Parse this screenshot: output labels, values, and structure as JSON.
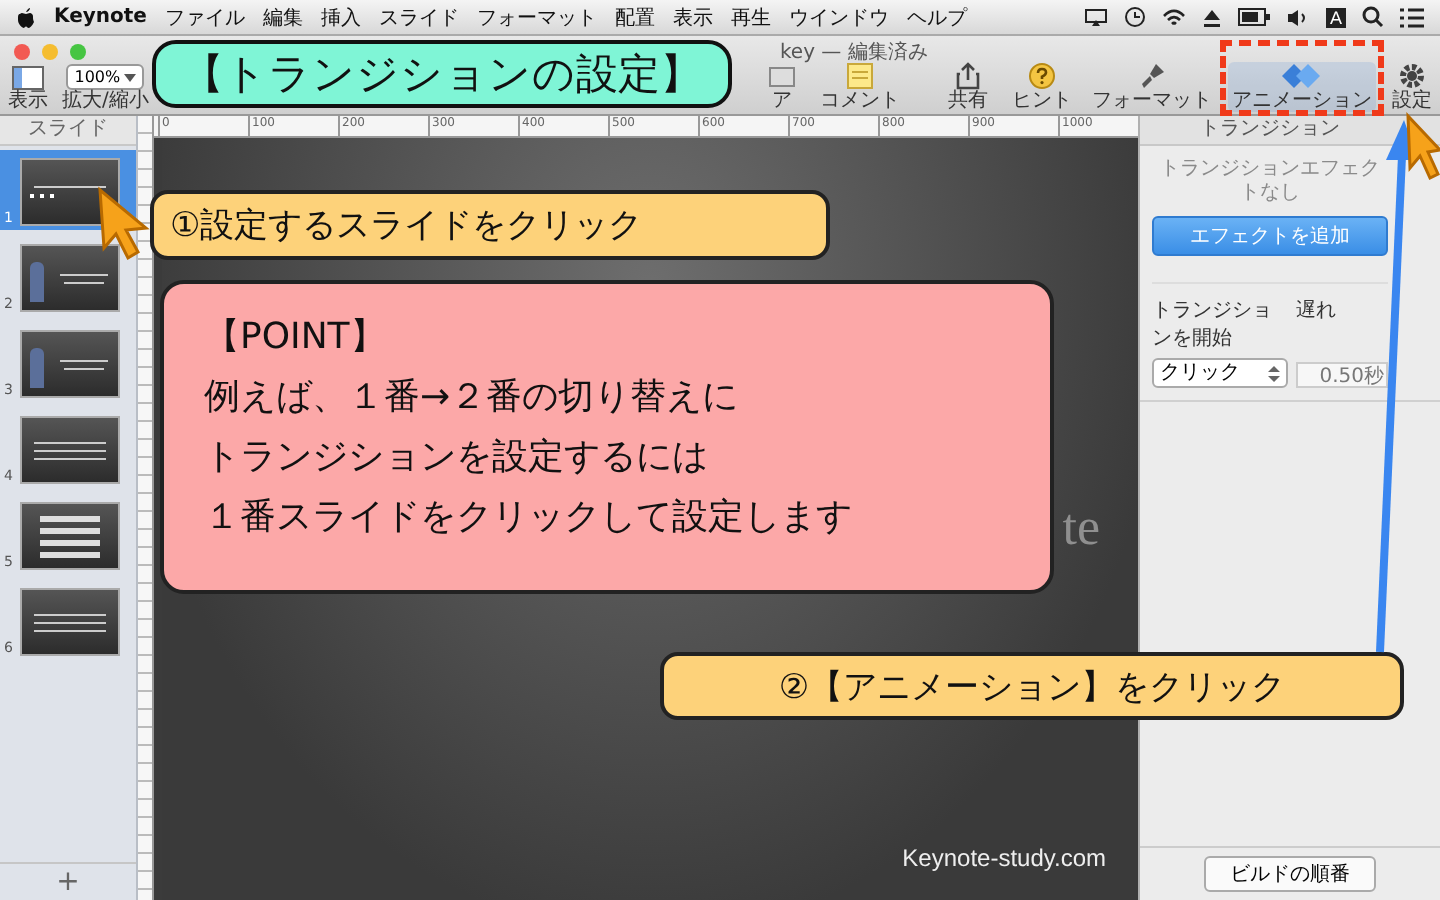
{
  "menu_bar": {
    "app": "Keynote",
    "items": [
      "ファイル",
      "編集",
      "挿入",
      "スライド",
      "フォーマット",
      "配置",
      "表示",
      "再生",
      "ウインドウ",
      "ヘルプ"
    ],
    "status_letter": "A"
  },
  "window": {
    "title": "key — 編集済み"
  },
  "toolbar": {
    "zoom": "100%",
    "left": [
      {
        "kind": "view",
        "label": "表示"
      },
      {
        "kind": "zoom",
        "label": "拡大/縮小"
      }
    ],
    "middle": [
      {
        "kind": "partial",
        "label": "ア"
      },
      {
        "kind": "comment",
        "label": "コメント"
      },
      {
        "kind": "share",
        "label": "共有"
      },
      {
        "kind": "hint",
        "label": "ヒント"
      }
    ],
    "right": [
      {
        "kind": "format",
        "label": "フォーマット",
        "selected": false
      },
      {
        "kind": "animation",
        "label": "アニメーション",
        "selected": true
      },
      {
        "kind": "settings",
        "label": "設定",
        "selected": false
      }
    ]
  },
  "sidebar": {
    "header": "スライド",
    "slides": [
      {
        "number": "1",
        "selected": true,
        "kind": "title"
      },
      {
        "number": "2",
        "selected": false,
        "kind": "person"
      },
      {
        "number": "3",
        "selected": false,
        "kind": "person"
      },
      {
        "number": "4",
        "selected": false,
        "kind": "text"
      },
      {
        "number": "5",
        "selected": false,
        "kind": "list"
      },
      {
        "number": "6",
        "selected": false,
        "kind": "text"
      }
    ],
    "add": "+"
  },
  "ruler": {
    "ticks": [
      "0",
      "100",
      "200",
      "300",
      "400",
      "500",
      "600",
      "700",
      "800",
      "900",
      "1000"
    ]
  },
  "slide": {
    "title_fragment": "te",
    "footer": "Keynote-study.com"
  },
  "inspector": {
    "tab": "トランジション",
    "empty_text": "トランジションエフェクトなし",
    "add_button": "エフェクトを追加",
    "start_label": "トランジションを開始",
    "start_value": "クリック",
    "delay_label": "遅れ",
    "delay_value": "0.50秒",
    "build_order_button": "ビルドの順番"
  },
  "annotations": {
    "banner": "【トランジションの設定】",
    "callout_1": "①設定するスライドをクリック",
    "point": {
      "heading": "【POINT】",
      "lines": [
        "例えば、１番→２番の切り替えに",
        "トランジションを設定するには",
        "１番スライドをクリックして設定します"
      ]
    },
    "callout_2": "②【アニメーション】をクリック"
  }
}
